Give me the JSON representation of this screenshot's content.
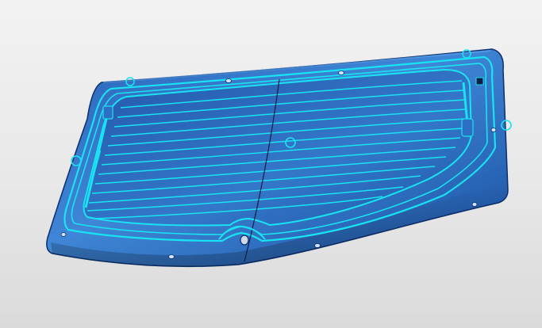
{
  "viewport": {
    "background_top": "#f2f2f2",
    "background_bottom": "#dadada"
  },
  "model": {
    "part": "rear-window-glass",
    "body_color_light": "#3f86d6",
    "body_color_dark": "#1a4fa0",
    "edge_color": "#0c2f6b",
    "highlight_color": "#19e3f2",
    "defroster_line_count": 14,
    "markers": [
      "clip-marker",
      "clip-marker",
      "clip-marker",
      "clip-marker",
      "clip-marker"
    ]
  }
}
